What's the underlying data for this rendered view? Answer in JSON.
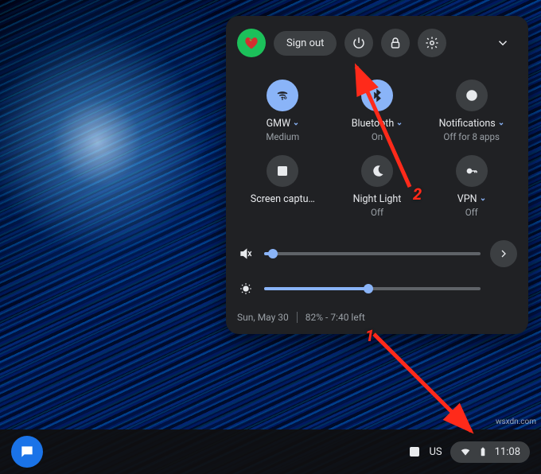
{
  "header": {
    "sign_out_label": "Sign out"
  },
  "tiles": {
    "wifi": {
      "label": "GMW",
      "sub": "Medium"
    },
    "bluetooth": {
      "label": "Bluetooth",
      "sub": "On"
    },
    "notifications": {
      "label": "Notifications",
      "sub": "Off for 8 apps"
    },
    "screen_capture": {
      "label": "Screen captu…",
      "sub": ""
    },
    "night_light": {
      "label": "Night Light",
      "sub": "Off"
    },
    "vpn": {
      "label": "VPN",
      "sub": "Off"
    }
  },
  "sliders": {
    "volume_pct": 4,
    "brightness_pct": 48
  },
  "footer": {
    "date": "Sun, May 30",
    "battery": "82% - 7:40 left"
  },
  "shelf": {
    "ime": "US",
    "time": "11:08"
  },
  "annotations": {
    "one": "1",
    "two": "2"
  },
  "watermark": "wsxdn.com"
}
